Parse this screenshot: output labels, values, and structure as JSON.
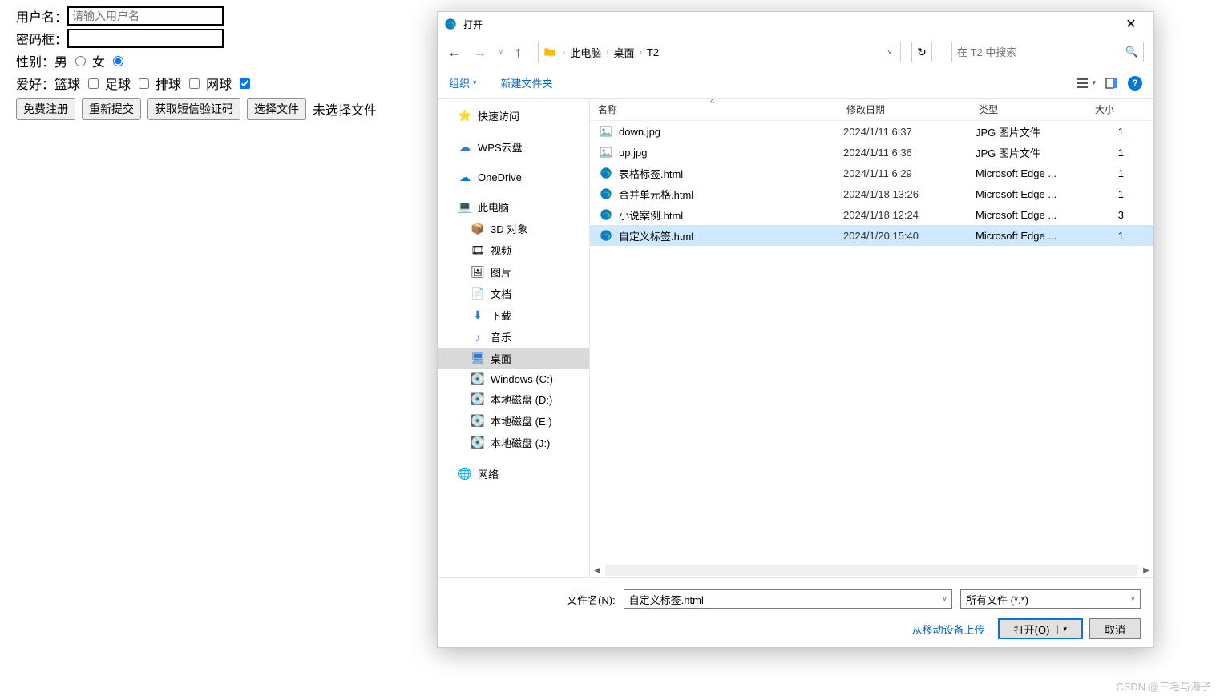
{
  "form": {
    "username_label": "用户名：",
    "username_placeholder": "请输入用户名",
    "password_label": "密码框：",
    "gender_label": "性别：",
    "gender_male": "男",
    "gender_female": "女",
    "hobby_label": "爱好：",
    "hobby_basketball": "篮球",
    "hobby_football": "足球",
    "hobby_volleyball": "排球",
    "hobby_tennis": "网球",
    "btn_register": "免费注册",
    "btn_reset": "重新提交",
    "btn_sms": "获取短信验证码",
    "btn_choose": "选择文件",
    "no_file": "未选择文件"
  },
  "dialog": {
    "title": "打开",
    "breadcrumb": {
      "root": "此电脑",
      "b1": "桌面",
      "b2": "T2"
    },
    "search_placeholder": "在 T2 中搜索",
    "toolbar": {
      "organize": "组织",
      "new_folder": "新建文件夹"
    },
    "columns": {
      "name": "名称",
      "date": "修改日期",
      "type": "类型",
      "size": "大小"
    },
    "sidebar": {
      "quick": "快速访问",
      "wps": "WPS云盘",
      "onedrive": "OneDrive",
      "thispc": "此电脑",
      "objects3d": "3D 对象",
      "videos": "视频",
      "pictures": "图片",
      "documents": "文档",
      "downloads": "下载",
      "music": "音乐",
      "desktop": "桌面",
      "drive_c": "Windows (C:)",
      "drive_d": "本地磁盘 (D:)",
      "drive_e": "本地磁盘 (E:)",
      "drive_j": "本地磁盘 (J:)",
      "network": "网络"
    },
    "files": [
      {
        "name": "down.jpg",
        "date": "2024/1/11 6:37",
        "type": "JPG 图片文件",
        "size": "1",
        "icon": "image"
      },
      {
        "name": "up.jpg",
        "date": "2024/1/11 6:36",
        "type": "JPG 图片文件",
        "size": "1",
        "icon": "image"
      },
      {
        "name": "表格标签.html",
        "date": "2024/1/11 6:29",
        "type": "Microsoft Edge ...",
        "size": "1",
        "icon": "edge"
      },
      {
        "name": "合并单元格.html",
        "date": "2024/1/18 13:26",
        "type": "Microsoft Edge ...",
        "size": "1",
        "icon": "edge"
      },
      {
        "name": "小说案例.html",
        "date": "2024/1/18 12:24",
        "type": "Microsoft Edge ...",
        "size": "3",
        "icon": "edge"
      },
      {
        "name": "自定义标签.html",
        "date": "2024/1/20 15:40",
        "type": "Microsoft Edge ...",
        "size": "1",
        "icon": "edge",
        "selected": true
      }
    ],
    "filename_label": "文件名(N):",
    "filename_value": "自定义标签.html",
    "filter_value": "所有文件 (*.*)",
    "upload_link": "从移动设备上传",
    "btn_open": "打开(O)",
    "btn_cancel": "取消"
  },
  "watermark": "CSDN @三毛与海子"
}
